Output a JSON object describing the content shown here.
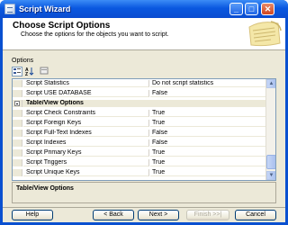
{
  "window": {
    "title": "Script Wizard",
    "minimize": "_",
    "maximize": "□",
    "close": "✕"
  },
  "header": {
    "title": "Choose Script Options",
    "subtitle": "Choose the options for the objects you want to script."
  },
  "options_label": "Options",
  "toolbar": {
    "categorized_icon": "categorized-icon",
    "alphabetical_icon": "alphabetical-icon",
    "property_pages_icon": "property-pages-icon"
  },
  "grid": {
    "rows": [
      {
        "type": "item",
        "name": "Script Statistics",
        "value": "Do not script statistics"
      },
      {
        "type": "item",
        "name": "Script USE DATABASE",
        "value": "False"
      },
      {
        "type": "category",
        "name": "Table/View Options",
        "value": ""
      },
      {
        "type": "item",
        "name": "Script Check Constraints",
        "value": "True"
      },
      {
        "type": "item",
        "name": "Script Foreign Keys",
        "value": "True"
      },
      {
        "type": "item",
        "name": "Script Full-Text Indexes",
        "value": "False"
      },
      {
        "type": "item",
        "name": "Script Indexes",
        "value": "False"
      },
      {
        "type": "item",
        "name": "Script Primary Keys",
        "value": "True"
      },
      {
        "type": "item",
        "name": "Script Triggers",
        "value": "True"
      },
      {
        "type": "item",
        "name": "Script Unique Keys",
        "value": "True"
      }
    ]
  },
  "description": {
    "title": "Table/View Options"
  },
  "buttons": {
    "help": "Help",
    "back": "< Back",
    "next": "Next >",
    "finish": "Finish >>|",
    "cancel": "Cancel"
  }
}
